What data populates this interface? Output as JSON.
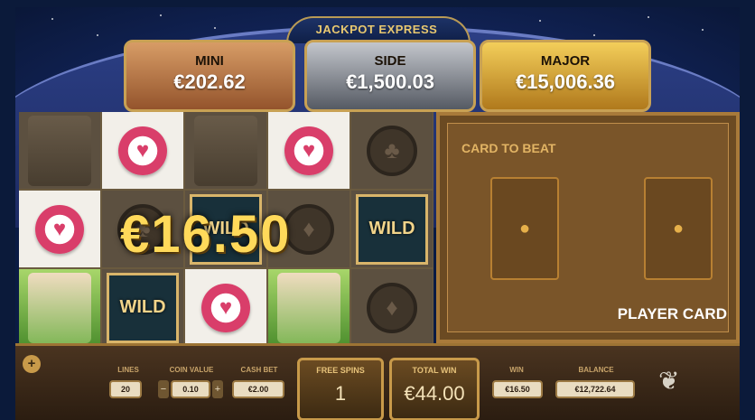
{
  "header": {
    "title": "JACKPOT EXPRESS"
  },
  "jackpots": {
    "mini": {
      "label": "MINI",
      "value": "€202.62"
    },
    "side": {
      "label": "SIDE",
      "value": "€1,500.03"
    },
    "major": {
      "label": "MAJOR",
      "value": "€15,006.36"
    }
  },
  "reels": {
    "win_amount": "€16.50",
    "wild_label": "WILD",
    "symbols": [
      [
        "lady-grey",
        "heart-chip",
        "lady-grey",
        "heart-chip",
        "club-chip"
      ],
      [
        "heart-chip",
        "club-chip",
        "wild",
        "diamond-chip",
        "wild"
      ],
      [
        "lady-colour",
        "wild",
        "heart-chip",
        "lady-colour",
        "diamond-chip"
      ]
    ]
  },
  "card_panel": {
    "card_to_beat": "CARD TO BEAT",
    "player_card": "PLAYER CARD"
  },
  "controls": {
    "lines_label": "LINES",
    "lines_value": "20",
    "coin_label": "COIN VALUE",
    "coin_value": "0.10",
    "coin_minus": "−",
    "coin_plus": "+",
    "cash_bet_label": "CASH BET",
    "cash_bet_value": "€2.00",
    "free_spins_label": "FREE SPINS",
    "free_spins_value": "1",
    "total_win_label": "TOTAL WIN",
    "total_win_value": "€44.00",
    "win_label": "WIN",
    "win_value": "€16.50",
    "balance_label": "BALANCE",
    "balance_value": "€12,722.64"
  },
  "icons": [
    "plus-icon",
    "yggdrasil-tree-icon"
  ]
}
